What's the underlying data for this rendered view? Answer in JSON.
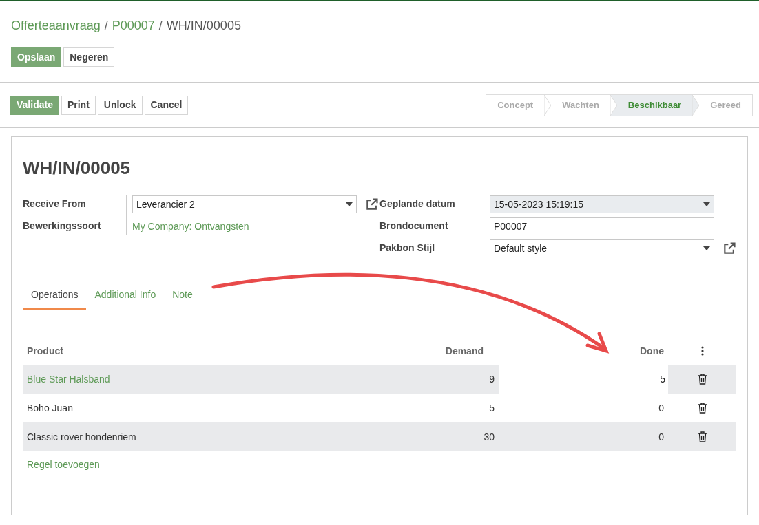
{
  "breadcrumb": [
    {
      "label": "Offerteaanvraag",
      "link": true
    },
    {
      "label": "P00007",
      "link": true
    },
    {
      "label": "WH/IN/00005",
      "link": false
    }
  ],
  "separator": "/",
  "edit_buttons": [
    {
      "label": "Opslaan",
      "primary": true
    },
    {
      "label": "Negeren",
      "primary": false
    }
  ],
  "action_buttons": [
    {
      "label": "Validate",
      "primary": true
    },
    {
      "label": "Print",
      "primary": false
    },
    {
      "label": "Unlock",
      "primary": false
    },
    {
      "label": "Cancel",
      "primary": false
    }
  ],
  "status_steps": [
    {
      "label": "Concept",
      "selected": false
    },
    {
      "label": "Wachten",
      "selected": false
    },
    {
      "label": "Beschikbaar",
      "selected": true
    },
    {
      "label": "Gereed",
      "selected": false
    }
  ],
  "title": "WH/IN/00005",
  "left_fields": [
    {
      "label": "Receive From",
      "kind": "select",
      "value": "Leverancier 2",
      "external_link": true
    },
    {
      "label": "Bewerkingssoort",
      "kind": "link",
      "value": "My Company: Ontvangsten",
      "external_link": false
    }
  ],
  "right_fields": [
    {
      "label": "Geplande datum",
      "kind": "date",
      "value": "15-05-2023 15:19:15",
      "external_link": false
    },
    {
      "label": "Brondocument",
      "kind": "text",
      "value": "P00007",
      "external_link": false
    },
    {
      "label": "Pakbon Stijl",
      "kind": "select",
      "value": "Default style",
      "external_link": true
    }
  ],
  "tabs": [
    {
      "label": "Operations",
      "selected": true
    },
    {
      "label": "Additional Info",
      "selected": false
    },
    {
      "label": "Note",
      "selected": false
    }
  ],
  "table": {
    "columns": [
      "Product",
      "Demand",
      "Done"
    ],
    "rows": [
      {
        "kind": "editing",
        "product": "Blue Star Halsband",
        "demand": "9",
        "done": "5"
      },
      {
        "kind": "normal",
        "product": "Boho Juan",
        "demand": "5",
        "done": "0"
      },
      {
        "kind": "normal",
        "product": "Classic rover hondenriem",
        "demand": "30",
        "done": "0"
      }
    ],
    "add_line": "Regel toevoegen"
  },
  "annotation": {
    "kind": "arrow"
  }
}
